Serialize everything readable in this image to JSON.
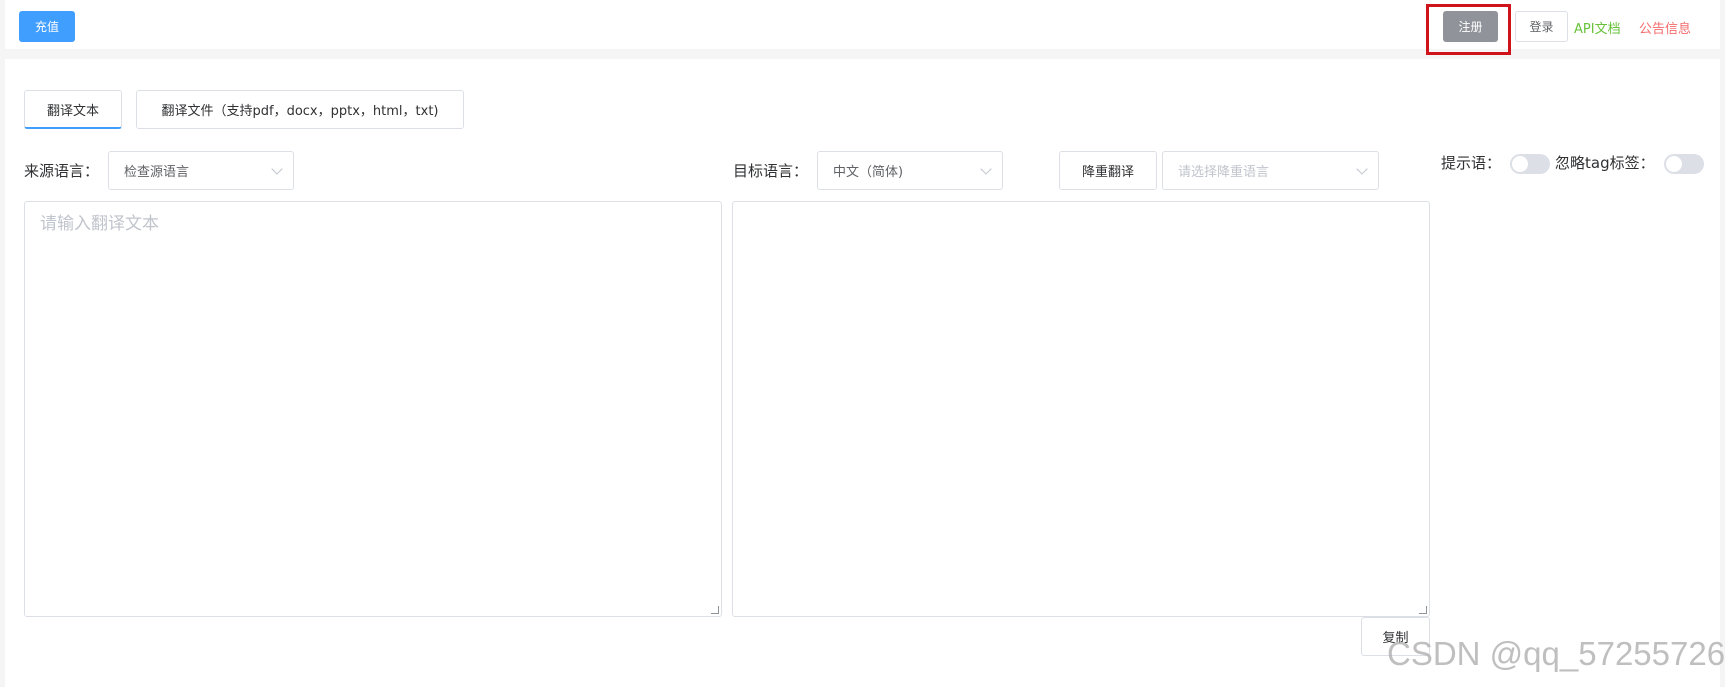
{
  "header": {
    "recharge_label": "充值",
    "register_label": "注册",
    "login_label": "登录",
    "api_docs_label": "API文档",
    "notice_label": "公告信息"
  },
  "tabs": {
    "text_label": "翻译文本",
    "file_label": "翻译文件（支持pdf，docx，pptx，html，txt)"
  },
  "controls": {
    "source_language_label": "来源语言：",
    "source_language_value": "检查源语言",
    "target_language_label": "目标语言：",
    "target_language_value": "中文（简体)",
    "degrade_translate_label": "降重翻译",
    "degrade_language_placeholder": "请选择降重语言",
    "prompt_label": "提示语：",
    "ignore_tag_label": "忽略tag标签："
  },
  "editor": {
    "source_placeholder": "请输入翻译文本",
    "target_value": "",
    "copy_label": "复制"
  },
  "watermark": "CSDN @qq_57255726",
  "colors": {
    "primary": "#409eff",
    "register_gray": "#909399",
    "api_green": "#67c23a",
    "notice_red": "#f56c6c",
    "highlight_red": "#d0121b"
  }
}
